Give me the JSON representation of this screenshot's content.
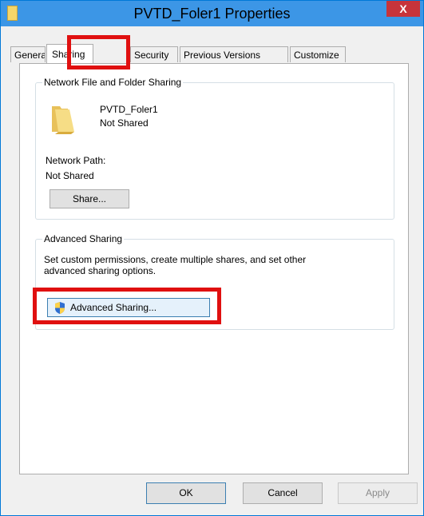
{
  "window": {
    "title": "PVTD_Foler1 Properties",
    "close_glyph": "X"
  },
  "tabs": [
    {
      "label": "General"
    },
    {
      "label": "Sharing"
    },
    {
      "label": "Security"
    },
    {
      "label": "Previous Versions"
    },
    {
      "label": "Customize"
    }
  ],
  "network_sharing": {
    "group_label": "Network File and Folder Sharing",
    "folder_name": "PVTD_Foler1",
    "folder_status": "Not Shared",
    "path_label": "Network Path:",
    "path_value": "Not Shared",
    "share_button": "Share..."
  },
  "advanced_sharing": {
    "group_label": "Advanced Sharing",
    "description_line1": "Set custom permissions, create multiple shares, and set other",
    "description_line2": "advanced sharing options.",
    "button_label": "Advanced Sharing...",
    "button_icon": "uac-shield-icon"
  },
  "footer": {
    "ok_label": "OK",
    "cancel_label": "Cancel",
    "apply_label": "Apply"
  },
  "colors": {
    "titlebar": "#3c96e6",
    "close": "#c7343b",
    "highlight": "#e01010"
  }
}
